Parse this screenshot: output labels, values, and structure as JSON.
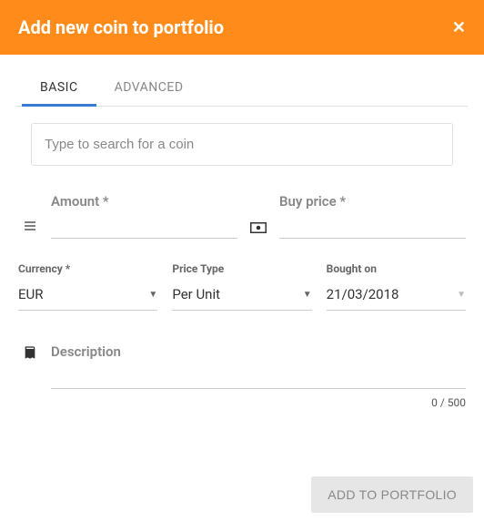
{
  "header": {
    "title": "Add new coin to portfolio"
  },
  "tabs": {
    "basic": "BASIC",
    "advanced": "ADVANCED"
  },
  "search": {
    "placeholder": "Type to search for a coin"
  },
  "fields": {
    "amount_label": "Amount *",
    "buyprice_label": "Buy price *",
    "currency_label": "Currency *",
    "currency_value": "EUR",
    "pricetype_label": "Price Type",
    "pricetype_value": "Per Unit",
    "boughton_label": "Bought on",
    "boughton_value": "21/03/2018",
    "description_label": "Description",
    "counter": "0 / 500"
  },
  "footer": {
    "add": "ADD TO PORTFOLIO"
  }
}
